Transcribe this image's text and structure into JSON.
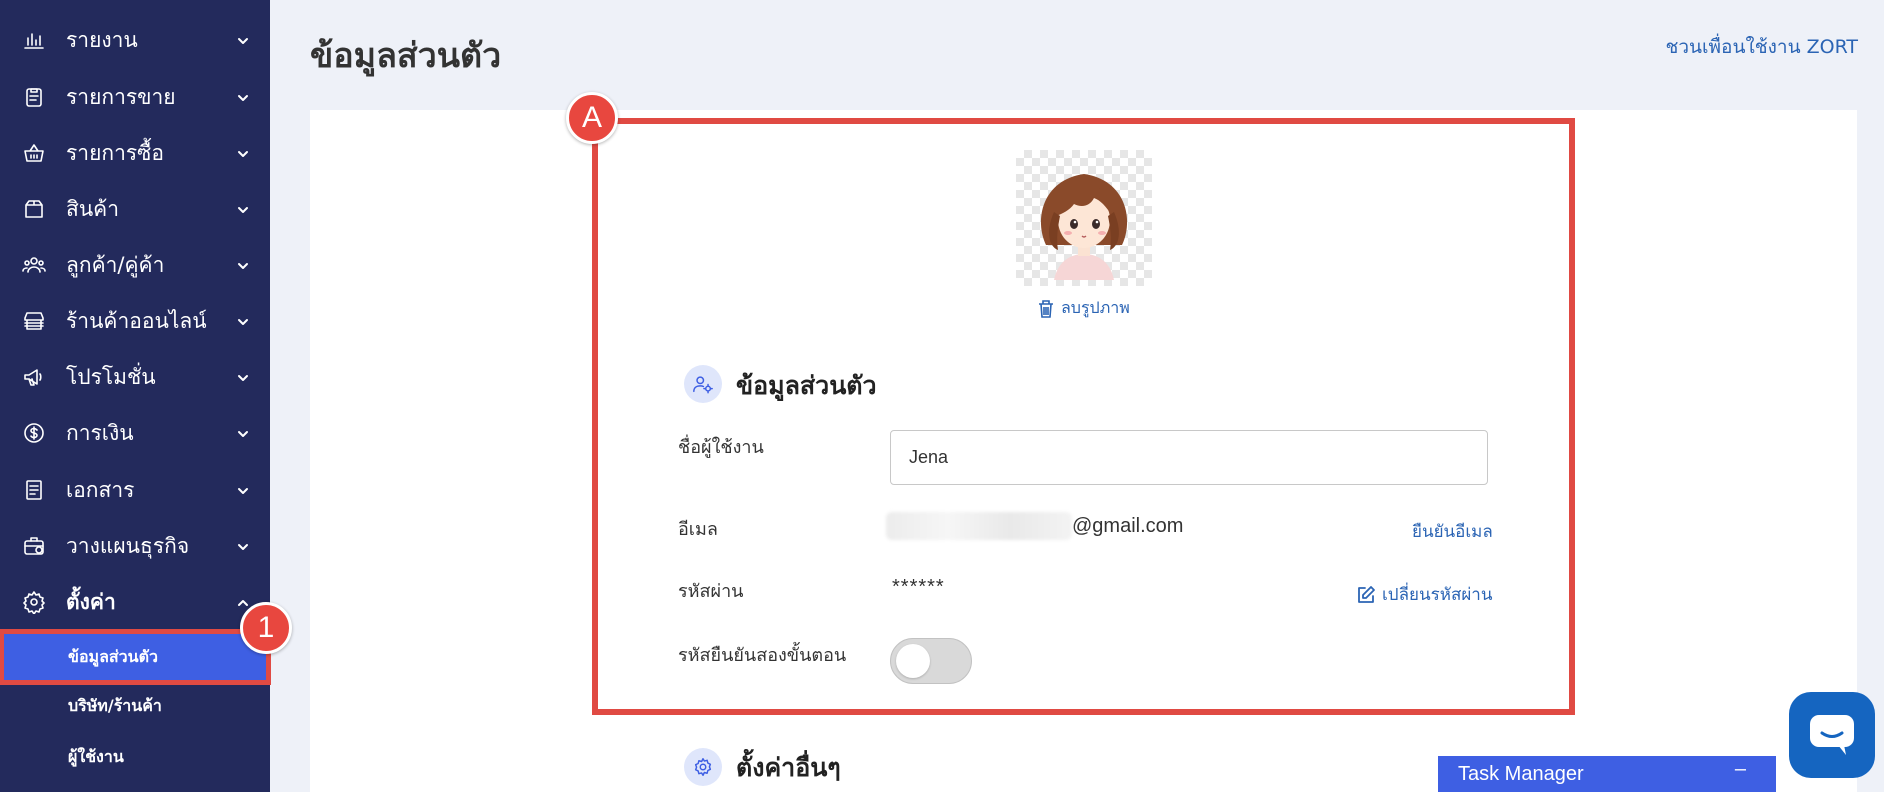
{
  "sidebar": {
    "items": [
      {
        "label": "รายงาน",
        "icon": "bar-chart-icon"
      },
      {
        "label": "รายการขาย",
        "icon": "clipboard-icon"
      },
      {
        "label": "รายการซื้อ",
        "icon": "basket-icon"
      },
      {
        "label": "สินค้า",
        "icon": "box-icon"
      },
      {
        "label": "ลูกค้า/คู่ค้า",
        "icon": "users-icon"
      },
      {
        "label": "ร้านค้าออนไลน์",
        "icon": "store-icon"
      },
      {
        "label": "โปรโมชั่น",
        "icon": "megaphone-icon"
      },
      {
        "label": "การเงิน",
        "icon": "dollar-coin-icon"
      },
      {
        "label": "เอกสาร",
        "icon": "document-icon"
      },
      {
        "label": "วางแผนธุรกิจ",
        "icon": "briefcase-icon"
      },
      {
        "label": "ตั้งค่า",
        "icon": "gear-icon"
      }
    ],
    "sub_items": [
      {
        "label": "ข้อมูลส่วนตัว"
      },
      {
        "label": "บริษัท/ร้านค้า"
      },
      {
        "label": "ผู้ใช้งาน"
      }
    ]
  },
  "annotations": {
    "badge_1": "1",
    "badge_a": "A"
  },
  "header": {
    "title": "ข้อมูลส่วนตัว",
    "invite_link": "ชวนเพื่อนใช้งาน ZORT"
  },
  "profile": {
    "delete_photo": "ลบรูปภาพ",
    "section_title": "ข้อมูลส่วนตัว",
    "username_label": "ชื่อผู้ใช้งาน",
    "username_value": "Jena",
    "email_label": "อีเมล",
    "email_domain": "@gmail.com",
    "verify_email": "ยืนยันอีเมล",
    "password_label": "รหัสผ่าน",
    "password_value": "******",
    "change_password": "เปลี่ยนรหัสผ่าน",
    "two_factor_label": "รหัสยืนยันสองขั้นตอน",
    "two_factor_enabled": false
  },
  "other_settings": {
    "title": "ตั้งค่าอื่นๆ"
  },
  "task_manager": {
    "label": "Task Manager",
    "minimize": "–"
  },
  "colors": {
    "sidebar_bg": "#232a5c",
    "accent": "#3e5fe3",
    "annotation": "#e04a43",
    "link": "#2b64b4"
  }
}
